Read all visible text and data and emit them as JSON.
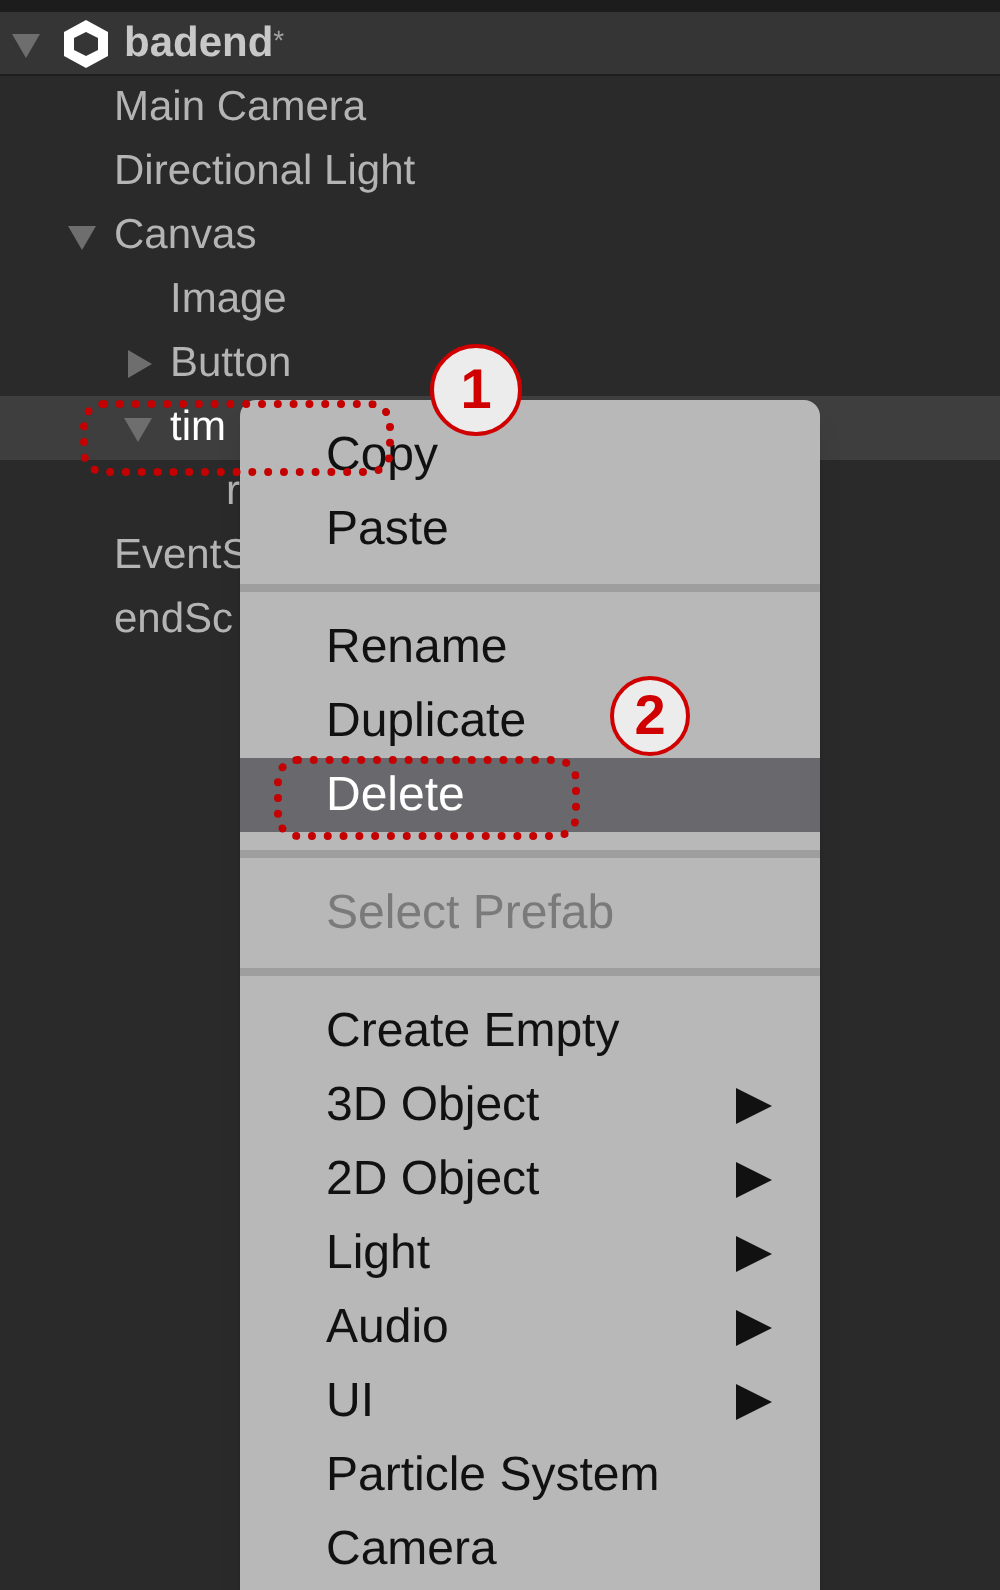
{
  "scene": {
    "name": "badend",
    "modified_mark": "*",
    "expanded": true,
    "children": [
      {
        "name": "Main Camera",
        "kind": "object",
        "selected": false
      },
      {
        "name": "Directional Light",
        "kind": "object",
        "selected": false
      },
      {
        "name": "Canvas",
        "kind": "group",
        "expanded": true,
        "selected": false,
        "children": [
          {
            "name": "Image",
            "kind": "object",
            "selected": false
          },
          {
            "name": "Button",
            "kind": "group",
            "expanded": false,
            "selected": false
          },
          {
            "name": "tim",
            "kind": "group",
            "expanded": true,
            "selected": true,
            "children": [
              {
                "name": "r",
                "kind": "object",
                "selected": false
              }
            ]
          }
        ]
      },
      {
        "name": "EventS",
        "kind": "object",
        "selected": false
      },
      {
        "name": "endSc",
        "kind": "object",
        "selected": false
      }
    ]
  },
  "context_menu": [
    {
      "kind": "item",
      "label": "Copy",
      "disabled": false,
      "selected": false,
      "submenu": false
    },
    {
      "kind": "item",
      "label": "Paste",
      "disabled": false,
      "selected": false,
      "submenu": false
    },
    {
      "kind": "separator"
    },
    {
      "kind": "item",
      "label": "Rename",
      "disabled": false,
      "selected": false,
      "submenu": false
    },
    {
      "kind": "item",
      "label": "Duplicate",
      "disabled": false,
      "selected": false,
      "submenu": false
    },
    {
      "kind": "item",
      "label": "Delete",
      "disabled": false,
      "selected": true,
      "submenu": false
    },
    {
      "kind": "separator"
    },
    {
      "kind": "item",
      "label": "Select Prefab",
      "disabled": true,
      "selected": false,
      "submenu": false
    },
    {
      "kind": "separator"
    },
    {
      "kind": "item",
      "label": "Create Empty",
      "disabled": false,
      "selected": false,
      "submenu": false
    },
    {
      "kind": "item",
      "label": "3D Object",
      "disabled": false,
      "selected": false,
      "submenu": true
    },
    {
      "kind": "item",
      "label": "2D Object",
      "disabled": false,
      "selected": false,
      "submenu": true
    },
    {
      "kind": "item",
      "label": "Light",
      "disabled": false,
      "selected": false,
      "submenu": true
    },
    {
      "kind": "item",
      "label": "Audio",
      "disabled": false,
      "selected": false,
      "submenu": true
    },
    {
      "kind": "item",
      "label": "UI",
      "disabled": false,
      "selected": false,
      "submenu": true
    },
    {
      "kind": "item",
      "label": "Particle System",
      "disabled": false,
      "selected": false,
      "submenu": false
    },
    {
      "kind": "item",
      "label": "Camera",
      "disabled": false,
      "selected": false,
      "submenu": false
    }
  ],
  "annotations": [
    {
      "label": "1"
    },
    {
      "label": "2"
    }
  ]
}
